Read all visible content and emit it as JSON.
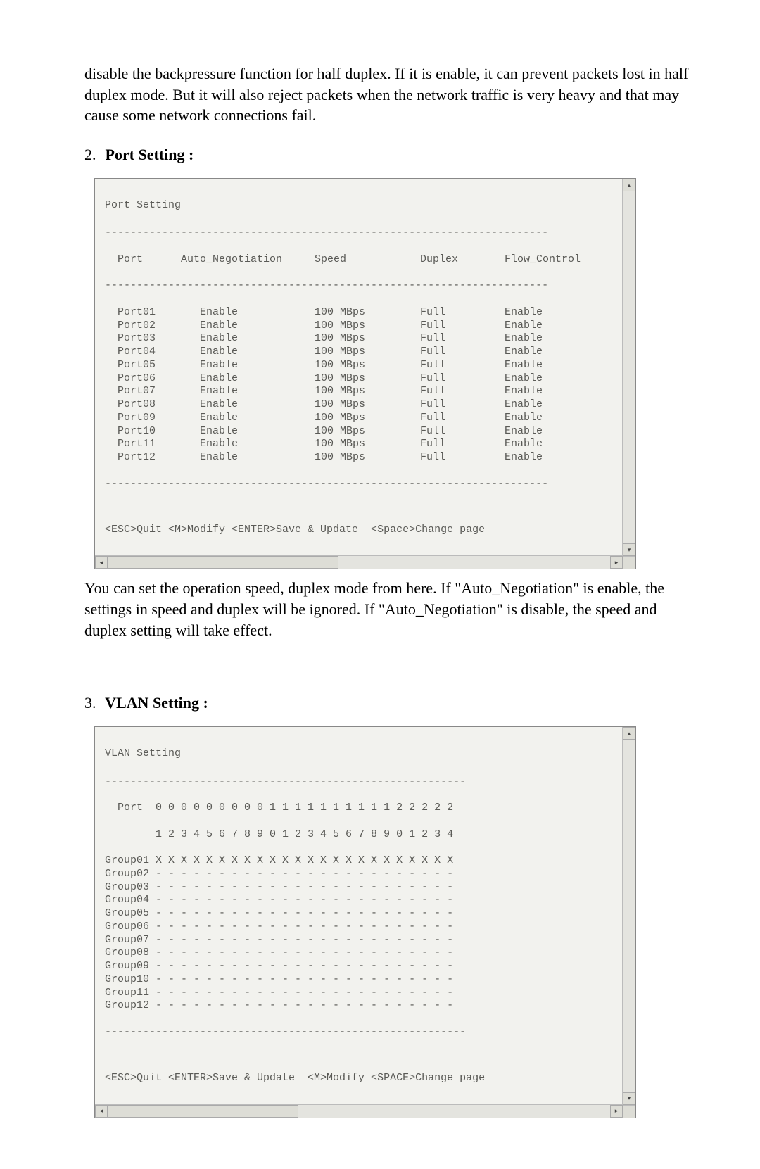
{
  "intro_paragraph": "disable the backpressure function for half duplex.   If it is enable, it can prevent packets lost in half duplex mode.   But it will also reject packets when the network traffic is very heavy and that may cause some network connections fail.",
  "sections": {
    "port": {
      "num": "2.",
      "title": "Port Setting",
      "colon": " :"
    },
    "vlan": {
      "num": "3.",
      "title": "VLAN Setting",
      "colon": " :"
    }
  },
  "port_window": {
    "title": "Port Setting",
    "sep": "----------------------------------------------------------------------",
    "header": {
      "port": "Port",
      "auto": "Auto_Negotiation",
      "speed": "Speed",
      "duplex": "Duplex",
      "flow": "Flow_Control"
    },
    "rows": [
      {
        "port": "Port01",
        "auto": "Enable",
        "speed": "100 MBps",
        "duplex": "Full",
        "flow": "Enable"
      },
      {
        "port": "Port02",
        "auto": "Enable",
        "speed": "100 MBps",
        "duplex": "Full",
        "flow": "Enable"
      },
      {
        "port": "Port03",
        "auto": "Enable",
        "speed": "100 MBps",
        "duplex": "Full",
        "flow": "Enable"
      },
      {
        "port": "Port04",
        "auto": "Enable",
        "speed": "100 MBps",
        "duplex": "Full",
        "flow": "Enable"
      },
      {
        "port": "Port05",
        "auto": "Enable",
        "speed": "100 MBps",
        "duplex": "Full",
        "flow": "Enable"
      },
      {
        "port": "Port06",
        "auto": "Enable",
        "speed": "100 MBps",
        "duplex": "Full",
        "flow": "Enable"
      },
      {
        "port": "Port07",
        "auto": "Enable",
        "speed": "100 MBps",
        "duplex": "Full",
        "flow": "Enable"
      },
      {
        "port": "Port08",
        "auto": "Enable",
        "speed": "100 MBps",
        "duplex": "Full",
        "flow": "Enable"
      },
      {
        "port": "Port09",
        "auto": "Enable",
        "speed": "100 MBps",
        "duplex": "Full",
        "flow": "Enable"
      },
      {
        "port": "Port10",
        "auto": "Enable",
        "speed": "100 MBps",
        "duplex": "Full",
        "flow": "Enable"
      },
      {
        "port": "Port11",
        "auto": "Enable",
        "speed": "100 MBps",
        "duplex": "Full",
        "flow": "Enable"
      },
      {
        "port": "Port12",
        "auto": "Enable",
        "speed": "100 MBps",
        "duplex": "Full",
        "flow": "Enable"
      }
    ],
    "footer": "<ESC>Quit <M>Modify <ENTER>Save & Update  <Space>Change page"
  },
  "port_explain": "You can set the operation speed, duplex mode from here.   If \"Auto_Negotiation\" is enable, the settings in speed and duplex will be ignored.   If \"Auto_Negotiation\" is disable, the speed and duplex setting will take effect.",
  "vlan_window": {
    "title": "VLAN Setting",
    "sep": "---------------------------------------------------------",
    "header1": "  Port  0 0 0 0 0 0 0 0 0 1 1 1 1 1 1 1 1 1 1 2 2 2 2 2",
    "header2": "        1 2 3 4 5 6 7 8 9 0 1 2 3 4 5 6 7 8 9 0 1 2 3 4",
    "groups": [
      {
        "name": "Group01",
        "marks": "X X X X X X X X X X X X X X X X X X X X X X X X"
      },
      {
        "name": "Group02",
        "marks": "- - - - - - - - - - - - - - - - - - - - - - - -"
      },
      {
        "name": "Group03",
        "marks": "- - - - - - - - - - - - - - - - - - - - - - - -"
      },
      {
        "name": "Group04",
        "marks": "- - - - - - - - - - - - - - - - - - - - - - - -"
      },
      {
        "name": "Group05",
        "marks": "- - - - - - - - - - - - - - - - - - - - - - - -"
      },
      {
        "name": "Group06",
        "marks": "- - - - - - - - - - - - - - - - - - - - - - - -"
      },
      {
        "name": "Group07",
        "marks": "- - - - - - - - - - - - - - - - - - - - - - - -"
      },
      {
        "name": "Group08",
        "marks": "- - - - - - - - - - - - - - - - - - - - - - - -"
      },
      {
        "name": "Group09",
        "marks": "- - - - - - - - - - - - - - - - - - - - - - - -"
      },
      {
        "name": "Group10",
        "marks": "- - - - - - - - - - - - - - - - - - - - - - - -"
      },
      {
        "name": "Group11",
        "marks": "- - - - - - - - - - - - - - - - - - - - - - - -"
      },
      {
        "name": "Group12",
        "marks": "- - - - - - - - - - - - - - - - - - - - - - - -"
      }
    ],
    "footer": "<ESC>Quit <ENTER>Save & Update  <M>Modify <SPACE>Change page"
  },
  "scroll_glyphs": {
    "up": "▴",
    "down": "▾",
    "left": "◂",
    "right": "▸"
  }
}
